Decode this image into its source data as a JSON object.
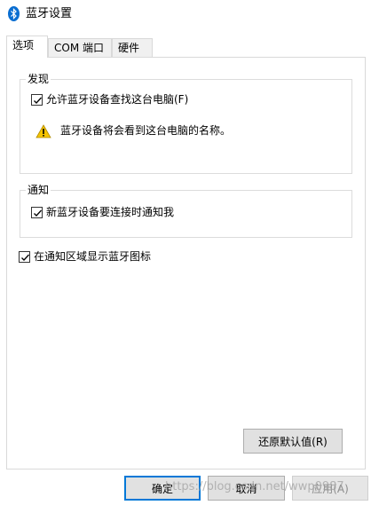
{
  "window": {
    "title": "蓝牙设置"
  },
  "tabs": [
    {
      "label": "选项",
      "active": true
    },
    {
      "label": "COM 端口",
      "active": false
    },
    {
      "label": "硬件",
      "active": false
    }
  ],
  "discovery": {
    "label": "发现",
    "allow_label": "允许蓝牙设备查找这台电脑(F)",
    "allow_checked": true,
    "warning": "蓝牙设备将会看到这台电脑的名称。"
  },
  "notify": {
    "label": "通知",
    "new_device_label": "新蓝牙设备要连接时通知我",
    "new_device_checked": true
  },
  "tray": {
    "label": "在通知区域显示蓝牙图标",
    "checked": true
  },
  "buttons": {
    "restore": "还原默认值(R)",
    "ok": "确定",
    "cancel": "取消",
    "apply": "应用(A)"
  },
  "watermark": "https://blog.csdn.net/wwp0987",
  "colors": {
    "bluetooth": "#0a6ed1",
    "warning": "#f5c400",
    "focus": "#0078d7"
  }
}
